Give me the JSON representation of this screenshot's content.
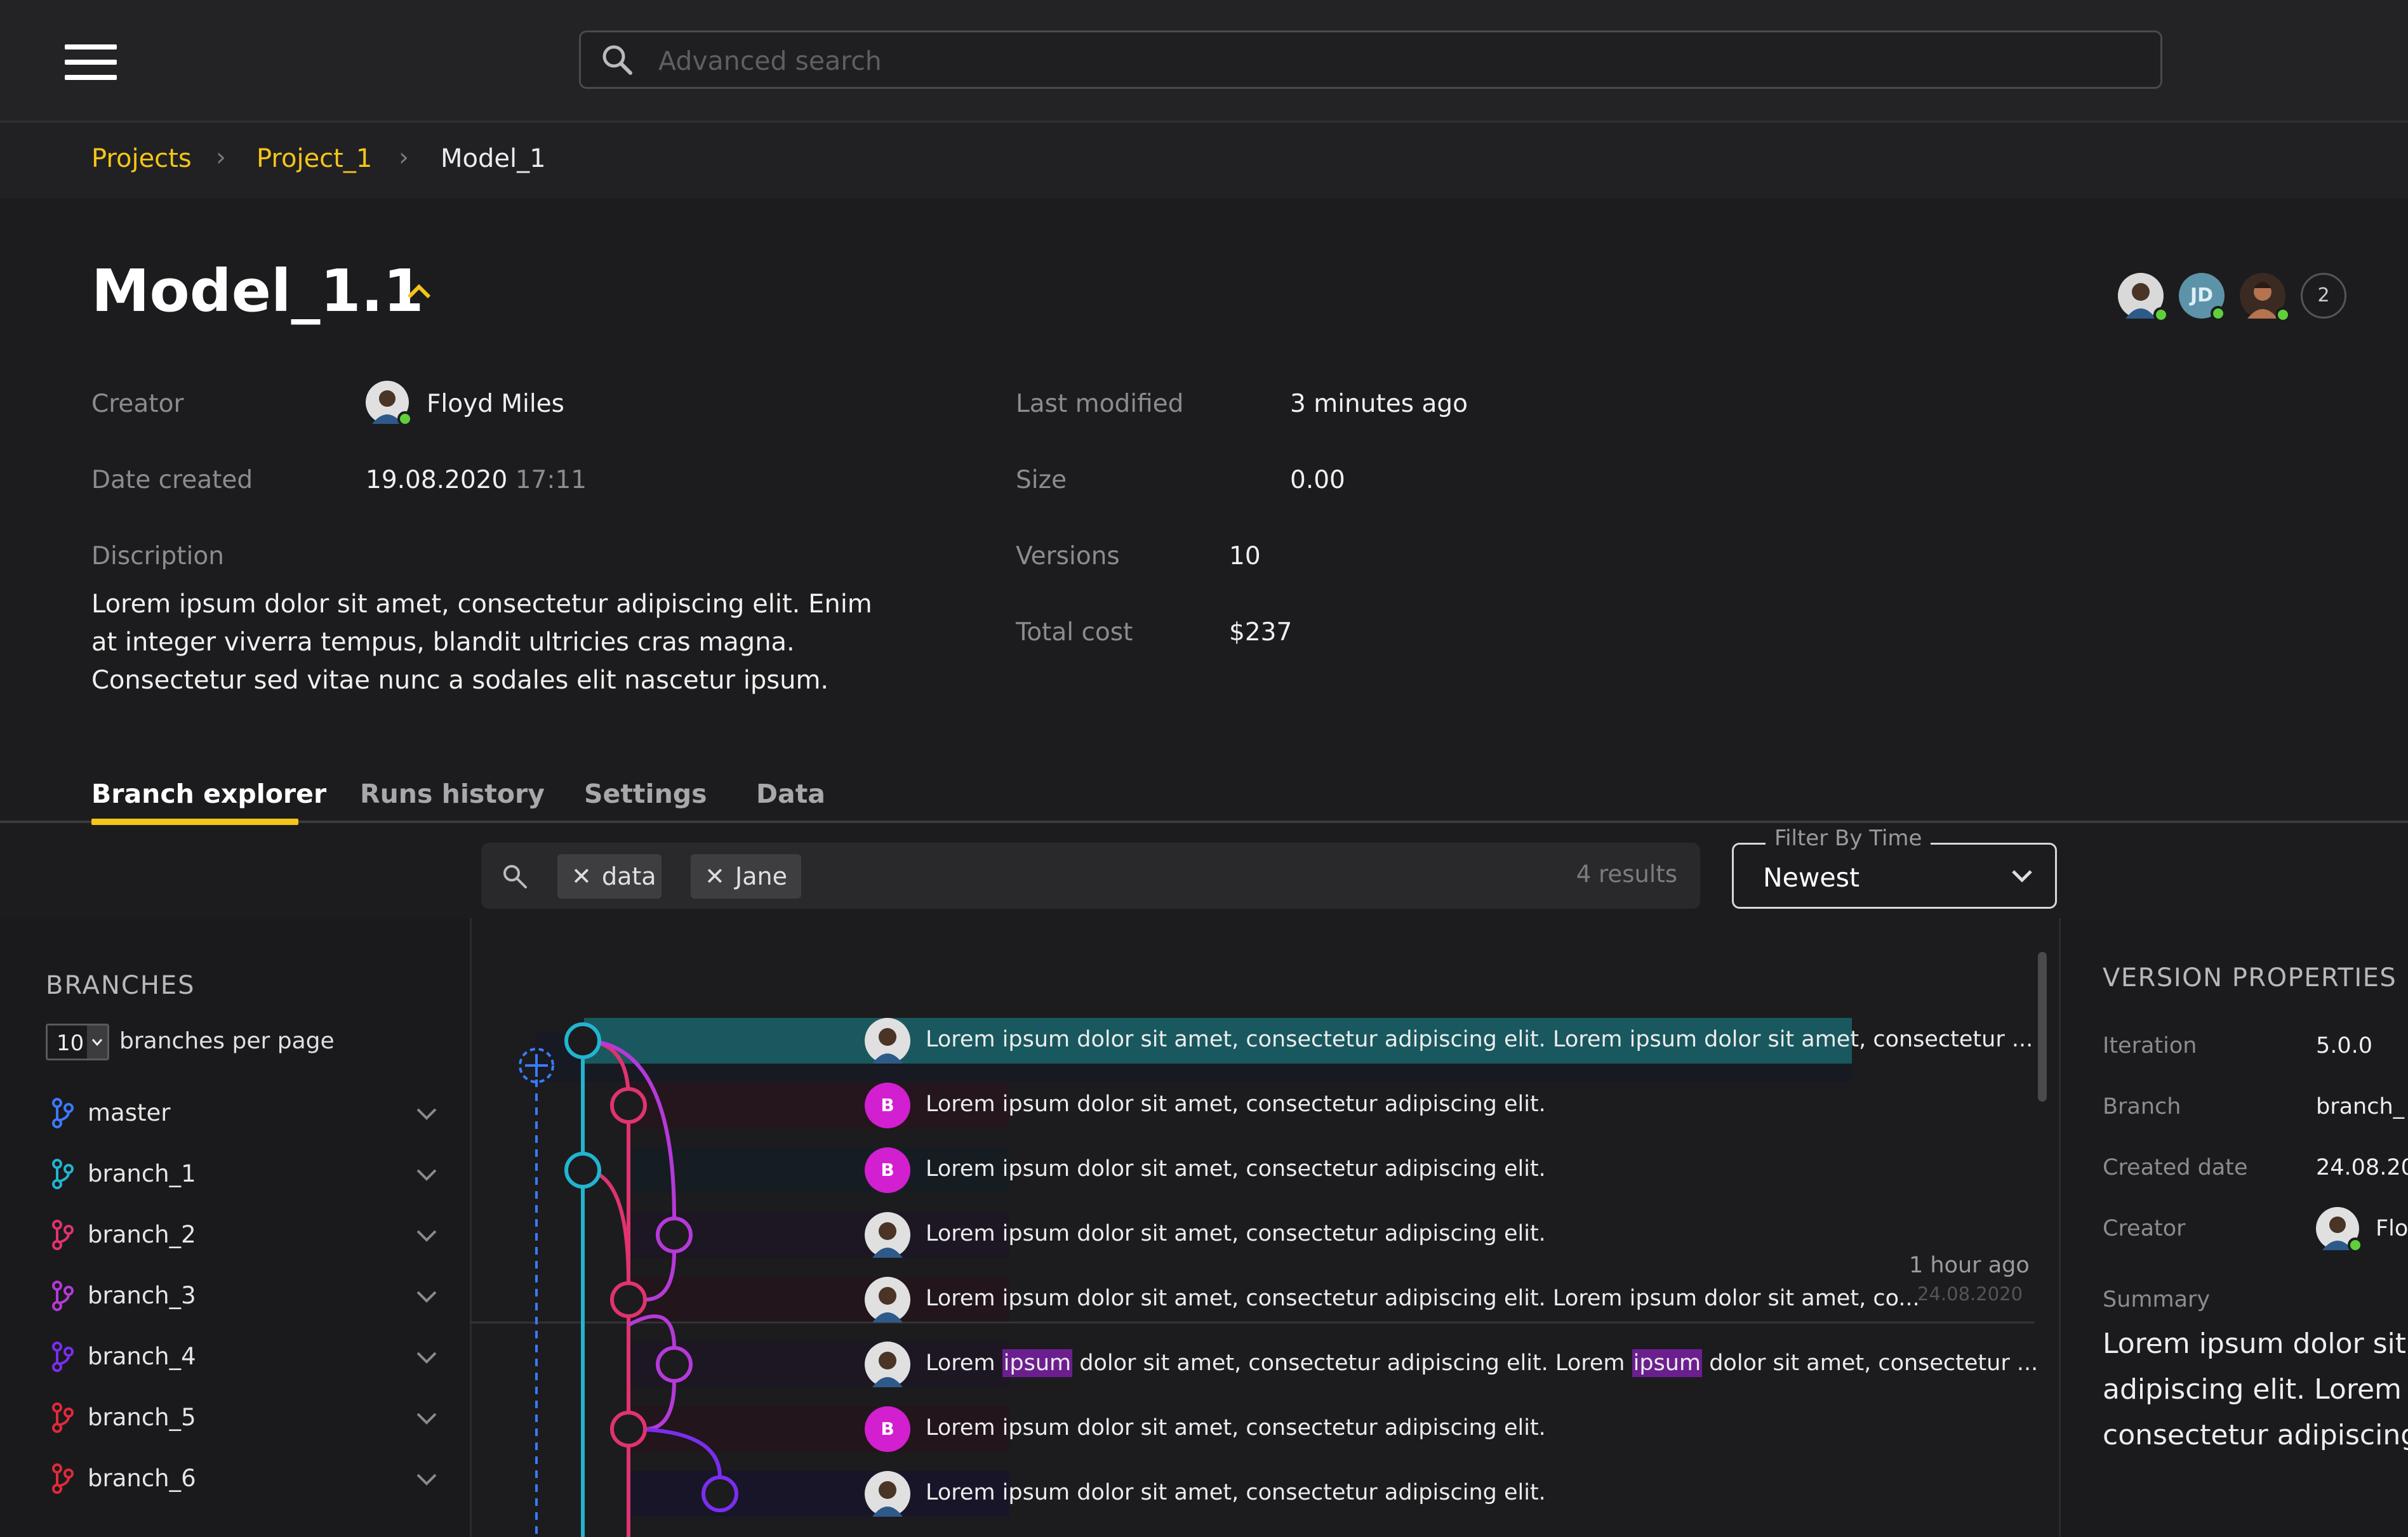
{
  "search": {
    "placeholder": "Advanced search"
  },
  "breadcrumb": {
    "items": [
      "Projects",
      "Project_1"
    ],
    "current": "Model_1"
  },
  "header": {
    "title": "Model_1.1",
    "collaborators": {
      "initials": "JD",
      "extra_count": "2"
    },
    "creator_label": "Creator",
    "creator_name": "Floyd Miles",
    "date_label": "Date created",
    "date": "19.08.2020",
    "time": "17:11",
    "desc_label": "Discription",
    "desc": "Lorem ipsum dolor sit amet, consectetur adipiscing elit. Enim at integer viverra tempus, blandit ultricies cras magna. Consectetur sed vitae nunc a sodales elit nascetur ipsum.",
    "modified_label": "Last modified",
    "modified": "3 minutes ago",
    "size_label": "Size",
    "size": "0.00",
    "versions_label": "Versions",
    "versions": "10",
    "cost_label": "Total cost",
    "cost": "$237"
  },
  "tabs": [
    "Branch explorer",
    "Runs history",
    "Settings",
    "Data"
  ],
  "filter": {
    "chips": [
      "data",
      "Jane"
    ],
    "results": "4 results",
    "time_label": "Filter By Time",
    "time_value": "Newest"
  },
  "sidebar": {
    "title": "BRANCHES",
    "per_page": "10",
    "per_page_label": "branches per page",
    "branches": [
      {
        "name": "master",
        "color": "#3a7bff"
      },
      {
        "name": "branch_1",
        "color": "#21b5d0"
      },
      {
        "name": "branch_2",
        "color": "#e0336f"
      },
      {
        "name": "branch_3",
        "color": "#b53ad8"
      },
      {
        "name": "branch_4",
        "color": "#7a2ef0"
      },
      {
        "name": "branch_5",
        "color": "#e02a3a"
      },
      {
        "name": "branch_6",
        "color": "#e02a3a"
      }
    ]
  },
  "commits": [
    {
      "avatar": "photo",
      "text": "Lorem ipsum dolor sit amet, consectetur adipiscing elit. Lorem ipsum dolor sit amet, consectetur ..."
    },
    {
      "avatar": "B",
      "text": "Lorem ipsum dolor sit amet, consectetur adipiscing elit."
    },
    {
      "avatar": "B",
      "text": "Lorem ipsum dolor sit amet, consectetur adipiscing elit."
    },
    {
      "avatar": "photo",
      "text": "Lorem ipsum dolor sit amet, consectetur adipiscing elit."
    },
    {
      "avatar": "photo",
      "text": "Lorem ipsum dolor sit amet, consectetur adipiscing elit. Lorem ipsum dolor sit amet, co..."
    },
    {
      "avatar": "photo",
      "parts": [
        "Lorem ",
        "ipsum",
        " dolor sit amet, consectetur adipiscing elit. Lorem ",
        "ipsum",
        " dolor sit amet, consectetur ..."
      ]
    },
    {
      "avatar": "B",
      "text": "Lorem ipsum dolor sit amet, consectetur adipiscing elit."
    },
    {
      "avatar": "photo",
      "text": "Lorem ipsum dolor sit amet, consectetur adipiscing elit."
    }
  ],
  "divider": {
    "time": "1 hour ago",
    "date": "24.08.2020"
  },
  "version_properties": {
    "title": "VERSION PROPERTIES",
    "iteration_label": "Iteration",
    "iteration": "5.0.0",
    "branch_label": "Branch",
    "branch": "branch_",
    "created_label": "Created date",
    "created": "24.08.20",
    "creator_label": "Creator",
    "creator": "Flo",
    "summary_label": "Summary",
    "summary": [
      "Lorem ipsum dolor sit",
      "adipiscing elit. Lorem i",
      "consectetur adipiscing"
    ]
  },
  "colors": {
    "accent": "#f5c518",
    "selected_row": "#19585f",
    "highlight": "#6b1f8f",
    "graph_master": "#3a7bff",
    "graph_cyan": "#21b5d0",
    "graph_pink": "#e0336f",
    "graph_purple": "#b53ad8",
    "graph_violet": "#7a2ef0",
    "online": "#5fd03a"
  }
}
